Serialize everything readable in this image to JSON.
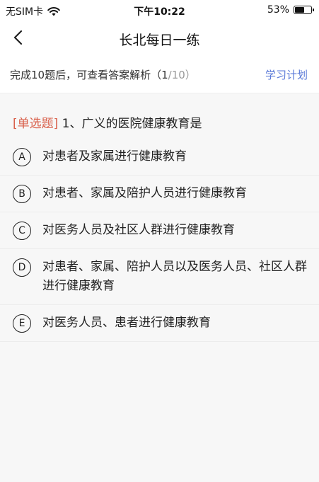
{
  "status_bar": {
    "carrier": "无SIM卡",
    "time": "下午10:22",
    "battery": "53%"
  },
  "nav": {
    "title": "长北每日一练"
  },
  "progress": {
    "prefix": "完成10题后，可查看答案解析（",
    "current": "1",
    "total": "/10",
    "suffix": "）",
    "plan_label": "学习计划"
  },
  "question": {
    "type_label": "[单选题]",
    "text": " 1、广义的医院健康教育是"
  },
  "options": [
    {
      "letter": "A",
      "text": "对患者及家属进行健康教育"
    },
    {
      "letter": "B",
      "text": "对患者、家属及陪护人员进行健康教育"
    },
    {
      "letter": "C",
      "text": "对医务人员及社区人群进行健康教育"
    },
    {
      "letter": "D",
      "text": "对患者、家属、陪护人员以及医务人员、社区人群进行健康教育"
    },
    {
      "letter": "E",
      "text": "对医务人员、患者进行健康教育"
    }
  ],
  "colors": {
    "accent": "#5b7ad8",
    "question_type": "#d9604b"
  }
}
